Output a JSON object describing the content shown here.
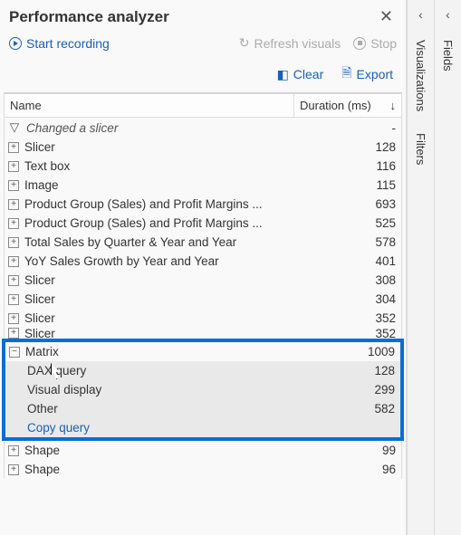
{
  "header": {
    "title": "Performance analyzer"
  },
  "toolbar": {
    "start_recording": "Start recording",
    "refresh_visuals": "Refresh visuals",
    "stop": "Stop",
    "clear": "Clear",
    "export": "Export"
  },
  "columns": {
    "name": "Name",
    "duration": "Duration (ms)"
  },
  "rows": [
    {
      "type": "filter",
      "label": "Changed a slicer",
      "duration": "-"
    },
    {
      "type": "item",
      "label": "Slicer",
      "duration": "128"
    },
    {
      "type": "item",
      "label": "Text box",
      "duration": "116"
    },
    {
      "type": "item",
      "label": "Image",
      "duration": "115"
    },
    {
      "type": "item",
      "label": "Product Group (Sales) and Profit Margins ...",
      "duration": "693"
    },
    {
      "type": "item",
      "label": "Product Group (Sales) and Profit Margins ...",
      "duration": "525"
    },
    {
      "type": "item",
      "label": "Total Sales by Quarter & Year and Year",
      "duration": "578"
    },
    {
      "type": "item",
      "label": "YoY Sales Growth by Year and Year",
      "duration": "401"
    },
    {
      "type": "item",
      "label": "Slicer",
      "duration": "308"
    },
    {
      "type": "item",
      "label": "Slicer",
      "duration": "304"
    },
    {
      "type": "item",
      "label": "Slicer",
      "duration": "352"
    },
    {
      "type": "item",
      "label": "Slicer",
      "duration": "352"
    }
  ],
  "highlight": {
    "parent": {
      "label": "Matrix",
      "duration": "1009"
    },
    "sub": [
      {
        "label": "DAX query",
        "duration": "128"
      },
      {
        "label": "Visual display",
        "duration": "299"
      },
      {
        "label": "Other",
        "duration": "582"
      }
    ],
    "copy_query": "Copy query"
  },
  "rows_after": [
    {
      "type": "item",
      "label": "Shape",
      "duration": "99"
    },
    {
      "type": "item",
      "label": "Shape",
      "duration": "96"
    }
  ],
  "side_tabs": {
    "visualizations": "Visualizations",
    "filters": "Filters",
    "fields": "Fields"
  }
}
